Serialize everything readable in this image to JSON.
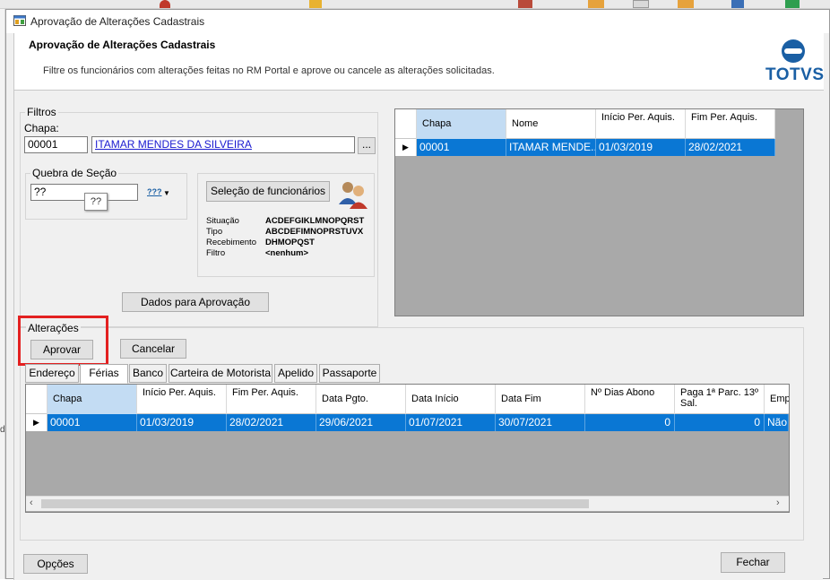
{
  "window": {
    "title": "Aprovação de Alterações Cadastrais"
  },
  "header": {
    "title": "Aprovação de Alterações Cadastrais",
    "description": "Filtre os funcionários com alterações feitas no RM Portal e aprove ou cancele as alterações solicitadas.",
    "logo_text": "TOTVS"
  },
  "filters": {
    "group_label": "Filtros",
    "chapa_label": "Chapa:",
    "chapa_value": "00001",
    "employee_name": "ITAMAR MENDES DA SILVEIRA",
    "browse_label": "...",
    "quebra_label": "Quebra de Seção",
    "quebra_value": "??",
    "quebra_tooltip": "??",
    "quebra_icon_text": "???",
    "selecao_button": "Seleção de funcionários",
    "info": [
      {
        "key": "Situação",
        "value": "ACDEFGIKLMNOPQRST"
      },
      {
        "key": "Tipo",
        "value": "ABCDEFIMNOPRSTUVX"
      },
      {
        "key": "Recebimento",
        "value": "DHMOPQST"
      },
      {
        "key": "Filtro",
        "value": "<nenhum>"
      }
    ],
    "dados_button": "Dados para Aprovação"
  },
  "employee_grid": {
    "columns": [
      "Chapa",
      "Nome",
      "Início Per. Aquis.",
      "Fim Per. Aquis."
    ],
    "rows": [
      [
        "00001",
        "ITAMAR MENDE...",
        "01/03/2019",
        "28/02/2021"
      ]
    ]
  },
  "alteracoes": {
    "group_label": "Alterações",
    "aprovar_button": "Aprovar",
    "cancelar_button": "Cancelar",
    "tabs": [
      "Endereço",
      "Férias",
      "Banco",
      "Carteira de Motorista",
      "Apelido",
      "Passaporte"
    ],
    "active_tab": "Férias",
    "grid": {
      "columns": [
        "Chapa",
        "Início Per. Aquis.",
        "Fim Per. Aquis.",
        "Data Pgto.",
        "Data Início",
        "Data Fim",
        "Nº Dias Abono",
        "Paga 1ª Parc. 13º Sal.",
        "Emp"
      ],
      "rows": [
        [
          "00001",
          "01/03/2019",
          "28/02/2021",
          "29/06/2021",
          "01/07/2021",
          "30/07/2021",
          "0",
          "0",
          "Não"
        ]
      ]
    }
  },
  "footer": {
    "opcoes_button": "Opções",
    "fechar_button": "Fechar"
  },
  "colors": {
    "selection": "#0a77d4",
    "highlight_box": "#e32020",
    "logo": "#1a5fa4"
  }
}
